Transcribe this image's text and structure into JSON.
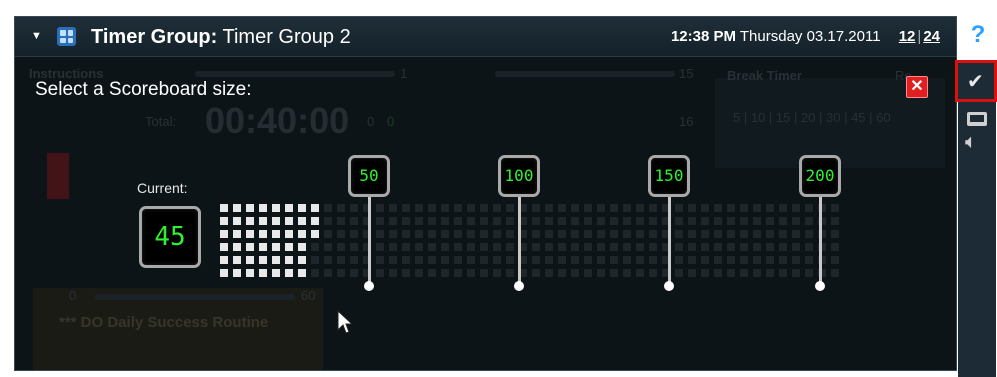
{
  "titlebar": {
    "label": "Timer Group:",
    "group_name": "Timer Group 2",
    "time": "12:38 PM",
    "date": "Thursday 03.17.2011",
    "format_12": "12",
    "format_24": "24",
    "collapse_icon": "triangle-down-icon",
    "app_icon": "grid-icon"
  },
  "background": {
    "section_label": "Instructions",
    "count_a": "1",
    "count_b": "15",
    "count_c": "16",
    "break_timer_label": "Break Timer",
    "repeat_label": "Re",
    "total_label": "Total:",
    "total_value": "00:40:00",
    "zero_a": "0",
    "zero_b": "0",
    "interval_options": "5 | 10 | 15 | 20 | 30 | 45 | 60",
    "slider_min": "0",
    "slider_max": "60",
    "routine_name": "*** DO Daily Success Routine"
  },
  "overlay": {
    "prompt": "Select a Scoreboard size:",
    "current_label": "Current:",
    "current_value": "45",
    "options": [
      "50",
      "100",
      "150",
      "200"
    ],
    "close_icon": "close-x-icon",
    "close_color": "#e02020",
    "lcd_color": "#2df22d"
  },
  "sidebar": {
    "help": "?",
    "help_color": "#2aa0ff",
    "highlight_color": "#dd1010",
    "icons": [
      "help-icon",
      "checkmark-icon",
      "scoreboard-icon",
      "speaker-icon"
    ]
  }
}
